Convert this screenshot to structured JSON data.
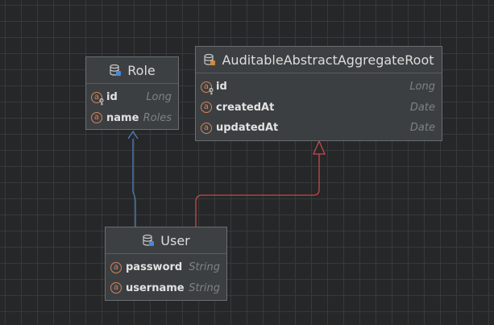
{
  "entities": {
    "role": {
      "title": "Role",
      "icon": "database-entity-icon",
      "attributes": [
        {
          "name": "id",
          "type": "Long",
          "primary_key": true
        },
        {
          "name": "name",
          "type": "Roles",
          "primary_key": false
        }
      ]
    },
    "root": {
      "title": "AuditableAbstractAggregateRoot",
      "icon": "database-entity-icon",
      "attributes": [
        {
          "name": "id",
          "type": "Long",
          "primary_key": true
        },
        {
          "name": "createdAt",
          "type": "Date",
          "primary_key": false
        },
        {
          "name": "updatedAt",
          "type": "Date",
          "primary_key": false
        }
      ]
    },
    "user": {
      "title": "User",
      "icon": "database-entity-icon",
      "attributes": [
        {
          "name": "password",
          "type": "String",
          "primary_key": false
        },
        {
          "name": "username",
          "type": "String",
          "primary_key": false
        }
      ]
    }
  },
  "relations": [
    {
      "from": "User",
      "to": "Role",
      "kind": "association",
      "color": "#4e7fc0"
    },
    {
      "from": "User",
      "to": "AuditableAbstractAggregateRoot",
      "kind": "inheritance",
      "color": "#c44a4a"
    }
  ],
  "colors": {
    "canvas": "#262728",
    "grid": "#37393b",
    "entity_fill": "#3c3f41",
    "entity_border": "#6b6e70",
    "attribute_icon": "#d6835a",
    "association_line": "#4e7fc0",
    "inheritance_line": "#c44a4a"
  }
}
